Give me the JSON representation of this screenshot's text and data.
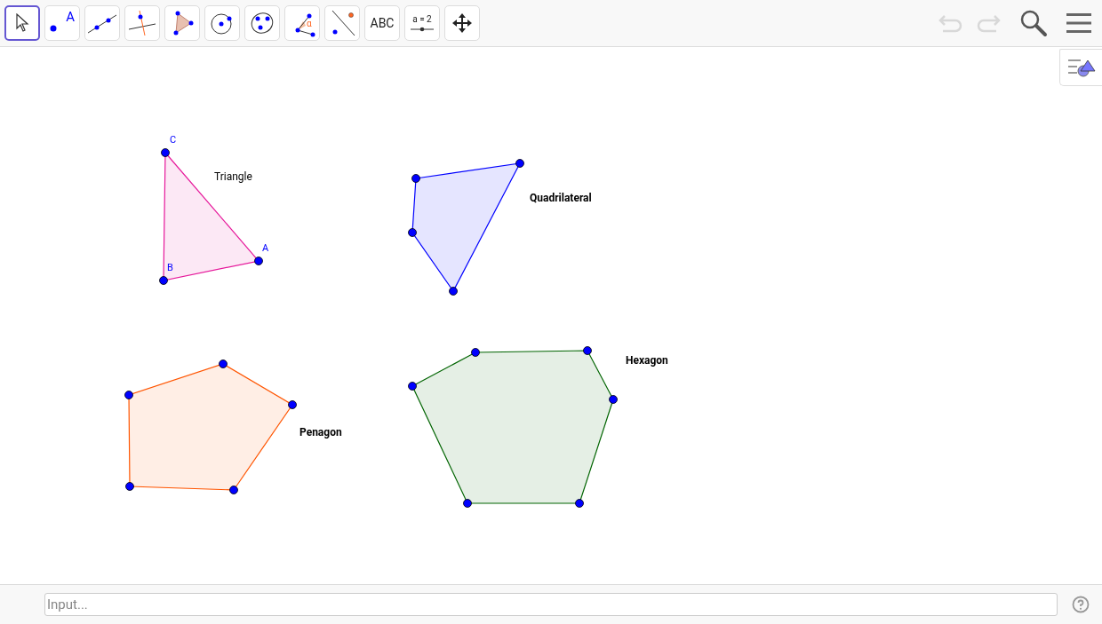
{
  "toolbar": {
    "tools": [
      {
        "kind": "move",
        "selected": true
      },
      {
        "kind": "point",
        "selected": false,
        "label": "A"
      },
      {
        "kind": "line",
        "selected": false
      },
      {
        "kind": "perpendicular",
        "selected": false
      },
      {
        "kind": "polygon",
        "selected": false
      },
      {
        "kind": "circle",
        "selected": false
      },
      {
        "kind": "conic",
        "selected": false
      },
      {
        "kind": "angle",
        "selected": false,
        "label": "α"
      },
      {
        "kind": "reflect",
        "selected": false
      },
      {
        "kind": "text",
        "selected": false,
        "label": "ABC"
      },
      {
        "kind": "slider",
        "selected": false,
        "label": "a = 2"
      },
      {
        "kind": "pan",
        "selected": false
      }
    ],
    "undo": {
      "disabled": true
    },
    "redo": {
      "disabled": true
    }
  },
  "shapes": [
    {
      "kind": "triangle",
      "label": "Triangle",
      "bold": false,
      "color": "#e6199b",
      "vertex_labels": [
        "C",
        "A",
        "B"
      ]
    },
    {
      "kind": "quadrilateral",
      "label": "Quadrilateral",
      "bold": true,
      "color": "#0000ff"
    },
    {
      "kind": "pentagon",
      "label": "Penagon",
      "bold": true,
      "color": "#ff5500"
    },
    {
      "kind": "hexagon",
      "label": "Hexagon",
      "bold": true,
      "color": "#006400"
    }
  ],
  "input_bar": {
    "placeholder": "Input..."
  }
}
